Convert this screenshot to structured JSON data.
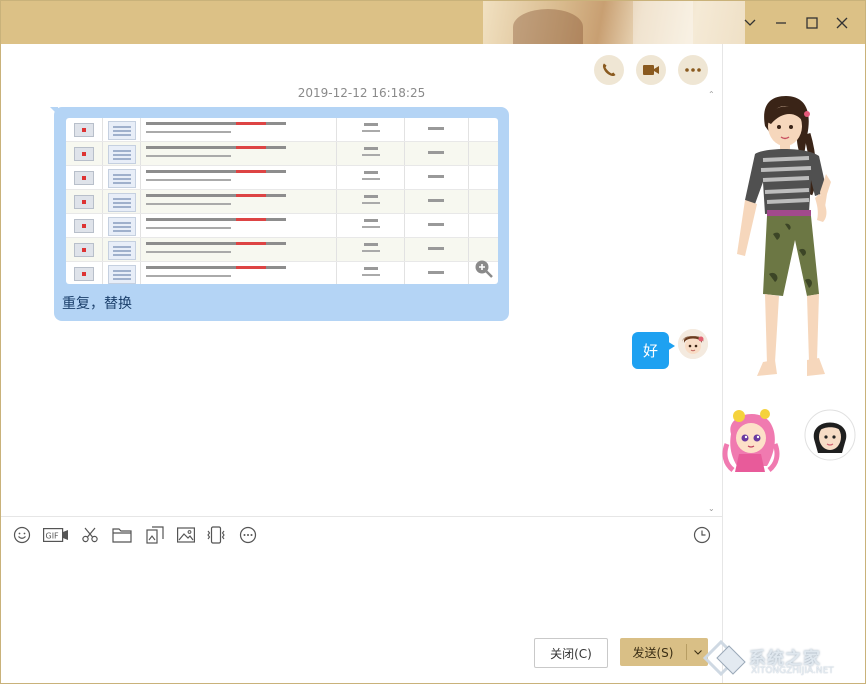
{
  "titlebar": {
    "dropdown_icon": "chevron-down-icon",
    "minimize_icon": "minimize-icon",
    "maximize_icon": "maximize-icon",
    "close_icon": "close-icon"
  },
  "chat": {
    "actions": [
      "phone-call-icon",
      "video-call-icon",
      "more-icon"
    ],
    "timestamp": "2019-12-12 16:18:25",
    "incoming_message": {
      "text": "重复，替换",
      "attachment_rows": 7
    },
    "outgoing_message": {
      "text": "好"
    }
  },
  "toolbar": {
    "tools": [
      "emoji-icon",
      "gif-icon",
      "scissors-icon",
      "folder-icon",
      "image-text-icon",
      "picture-icon",
      "shake-icon",
      "more-icon"
    ],
    "history_icon": "clock-icon"
  },
  "input": {
    "close_label": "关闭(C)",
    "send_label": "发送(S)"
  },
  "watermark": {
    "text": "系统之家",
    "sub": "XITONGZHIJIA.NET"
  },
  "colors": {
    "titlebar": "#dcc186",
    "incoming_bubble": "#b4d4f5",
    "outgoing_bubble": "#1ea1f1",
    "send_button": "#d9bf86"
  }
}
